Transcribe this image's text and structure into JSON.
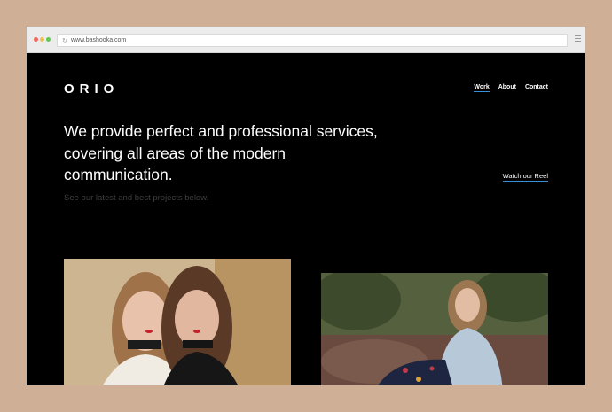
{
  "browser": {
    "url": "www.bashooka.com"
  },
  "site": {
    "logo": "ORIO",
    "nav": [
      {
        "label": "Work",
        "active": true
      },
      {
        "label": "About",
        "active": false
      },
      {
        "label": "Contact",
        "active": false
      }
    ],
    "hero_line1": "We provide perfect and professional services,",
    "hero_line2": "covering all areas of the modern",
    "hero_line3": "communication.",
    "subtitle": "See our latest and best projects below.",
    "reel_link": "Watch our Reel"
  },
  "colors": {
    "page_background": "#000000",
    "accent_underline": "#3a8fd6",
    "outer_background": "#cfb096"
  },
  "projects": [
    {
      "description": "photo-two-women"
    },
    {
      "description": "photo-woman-sitting"
    }
  ]
}
